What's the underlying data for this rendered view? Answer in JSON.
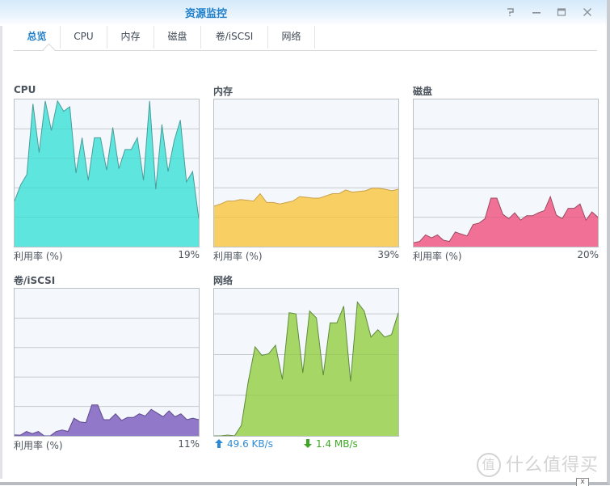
{
  "window": {
    "title": "资源监控",
    "buttons": {
      "help": "help-icon",
      "minimize": "minimize-icon",
      "maximize": "maximize-icon",
      "close": "close-icon"
    }
  },
  "tabs": [
    {
      "label": "总览",
      "active": true
    },
    {
      "label": "CPU",
      "active": false
    },
    {
      "label": "内存",
      "active": false
    },
    {
      "label": "磁盘",
      "active": false
    },
    {
      "label": "卷/iSCSI",
      "active": false
    },
    {
      "label": "网络",
      "active": false
    }
  ],
  "panels": {
    "cpu": {
      "title": "CPU",
      "footer_label": "利用率 (%)",
      "value": "19%"
    },
    "memory": {
      "title": "内存",
      "footer_label": "利用率 (%)",
      "value": "39%"
    },
    "disk": {
      "title": "磁盘",
      "footer_label": "利用率 (%)",
      "value": "20%"
    },
    "volume": {
      "title": "卷/iSCSI",
      "footer_label": "利用率 (%)",
      "value": "11%"
    },
    "network": {
      "title": "网络",
      "upload": "49.6 KB/s",
      "download": "1.4 MB/s"
    }
  },
  "watermark": {
    "logo": "值",
    "text": "什么值得买"
  },
  "chart_data": [
    {
      "type": "area",
      "title": "CPU",
      "ylabel": "利用率 (%)",
      "ylim": [
        0,
        100
      ],
      "grid": true,
      "gridlines": [
        20,
        40,
        60,
        80
      ],
      "color": "#5ee6de",
      "stroke": "#4a9c9a",
      "values": [
        31,
        42,
        49,
        97,
        64,
        99,
        79,
        99,
        92,
        95,
        50,
        74,
        45,
        74,
        74,
        52,
        81,
        53,
        66,
        66,
        74,
        45,
        99,
        39,
        83,
        51,
        72,
        86,
        44,
        51,
        19
      ]
    },
    {
      "type": "area",
      "title": "内存",
      "ylabel": "利用率 (%)",
      "ylim": [
        0,
        100
      ],
      "grid": true,
      "gridlines": [
        20,
        40,
        60,
        80
      ],
      "color": "#f8cf62",
      "stroke": "#c9a048",
      "values": [
        27.5,
        29,
        31,
        31,
        32,
        31.5,
        31,
        36,
        30,
        30,
        29,
        30,
        31,
        34,
        33.5,
        33,
        33,
        34.5,
        36,
        36,
        38.5,
        37,
        37.5,
        38,
        39.7,
        39.7,
        39,
        38,
        39
      ]
    },
    {
      "type": "area",
      "title": "磁盘",
      "ylabel": "利用率 (%)",
      "ylim": [
        0,
        100
      ],
      "grid": true,
      "gridlines": [
        20,
        40,
        60,
        80
      ],
      "color": "#f07195",
      "stroke": "#9c4a62",
      "values": [
        2.7,
        3.5,
        8,
        6,
        8,
        4.4,
        3.5,
        10,
        8.5,
        7.3,
        15,
        16,
        19,
        33,
        33,
        22,
        19,
        23,
        18,
        21,
        21,
        23,
        24.5,
        34,
        21.5,
        19,
        26,
        26,
        29,
        18,
        23.6,
        20
      ]
    },
    {
      "type": "area",
      "title": "卷/iSCSI",
      "ylabel": "利用率 (%)",
      "ylim": [
        0,
        100
      ],
      "grid": true,
      "gridlines": [
        20,
        40,
        60,
        80
      ],
      "color": "#9178c8",
      "stroke": "#5e4a8e",
      "values": [
        0.7,
        0.5,
        3,
        1.5,
        3,
        0,
        0,
        3,
        4,
        3,
        12,
        9.5,
        9,
        21,
        21,
        11,
        11,
        15,
        10.5,
        12.5,
        12.5,
        15,
        13.5,
        18,
        15.5,
        13,
        17,
        13,
        15,
        11,
        12,
        11
      ]
    },
    {
      "type": "area",
      "title": "网络",
      "upload": "49.6 KB/s",
      "download": "1.4 MB/s",
      "ylim": [
        0,
        3.62
      ],
      "grid": true,
      "gridlines": [
        1,
        2,
        3
      ],
      "color": "#a6d766",
      "stroke": "#5f8a3c",
      "values": [
        0,
        0,
        0.02,
        0,
        0.26,
        1.33,
        2.19,
        1.98,
        2.02,
        2.23,
        1.39,
        3.03,
        3.0,
        1.55,
        3.07,
        2.9,
        1.49,
        2.78,
        2.78,
        3.19,
        1.34,
        3.29,
        3.07,
        2.43,
        2.61,
        2.43,
        2.49,
        3.03
      ]
    }
  ]
}
